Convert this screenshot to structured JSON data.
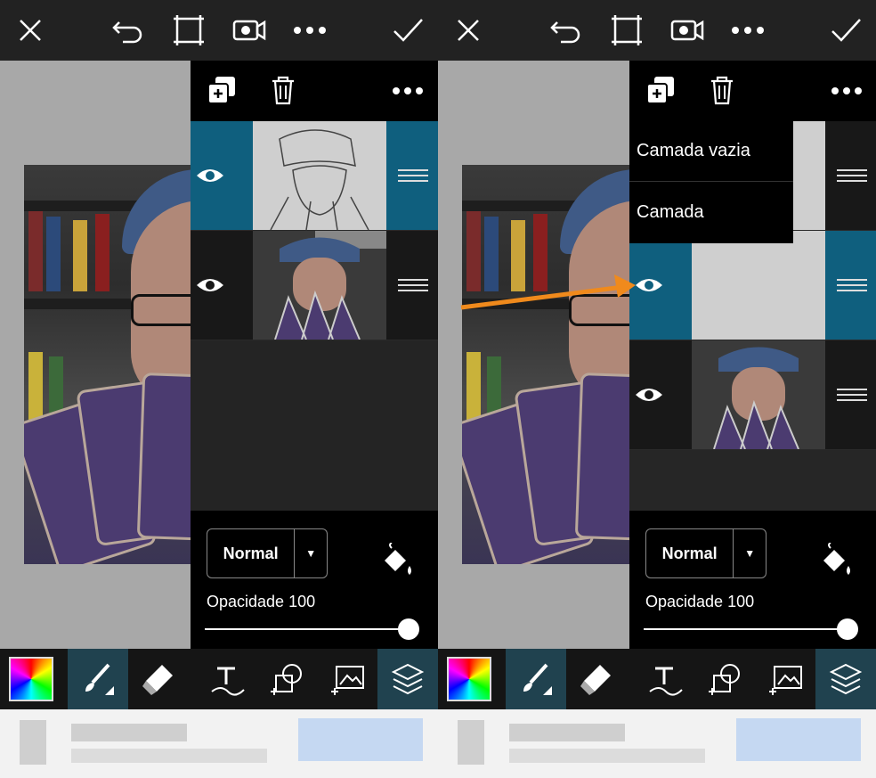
{
  "top_toolbar": {
    "icons": [
      "close-icon",
      "undo-icon",
      "crop-icon",
      "video-icon",
      "more-icon",
      "check-icon"
    ]
  },
  "layers_panel": {
    "header_icons": [
      "add-layer-icon",
      "trash-icon",
      "more-icon"
    ],
    "blend_mode": "Normal",
    "opacity_label": "Opacidade 100",
    "opacity_value": 100
  },
  "add_layer_menu": {
    "items": [
      "Camada vazia",
      "Camada"
    ]
  },
  "bottom_toolbar": {
    "tools": [
      "color-picker",
      "brush",
      "eraser",
      "text",
      "shapes",
      "add-image",
      "layers"
    ],
    "active": [
      "brush",
      "layers"
    ]
  },
  "colors": {
    "accent": "#0f5f7e",
    "annotation_arrow": "#f08a1c",
    "toolbar": "#222222",
    "active_tool": "#20424f"
  }
}
